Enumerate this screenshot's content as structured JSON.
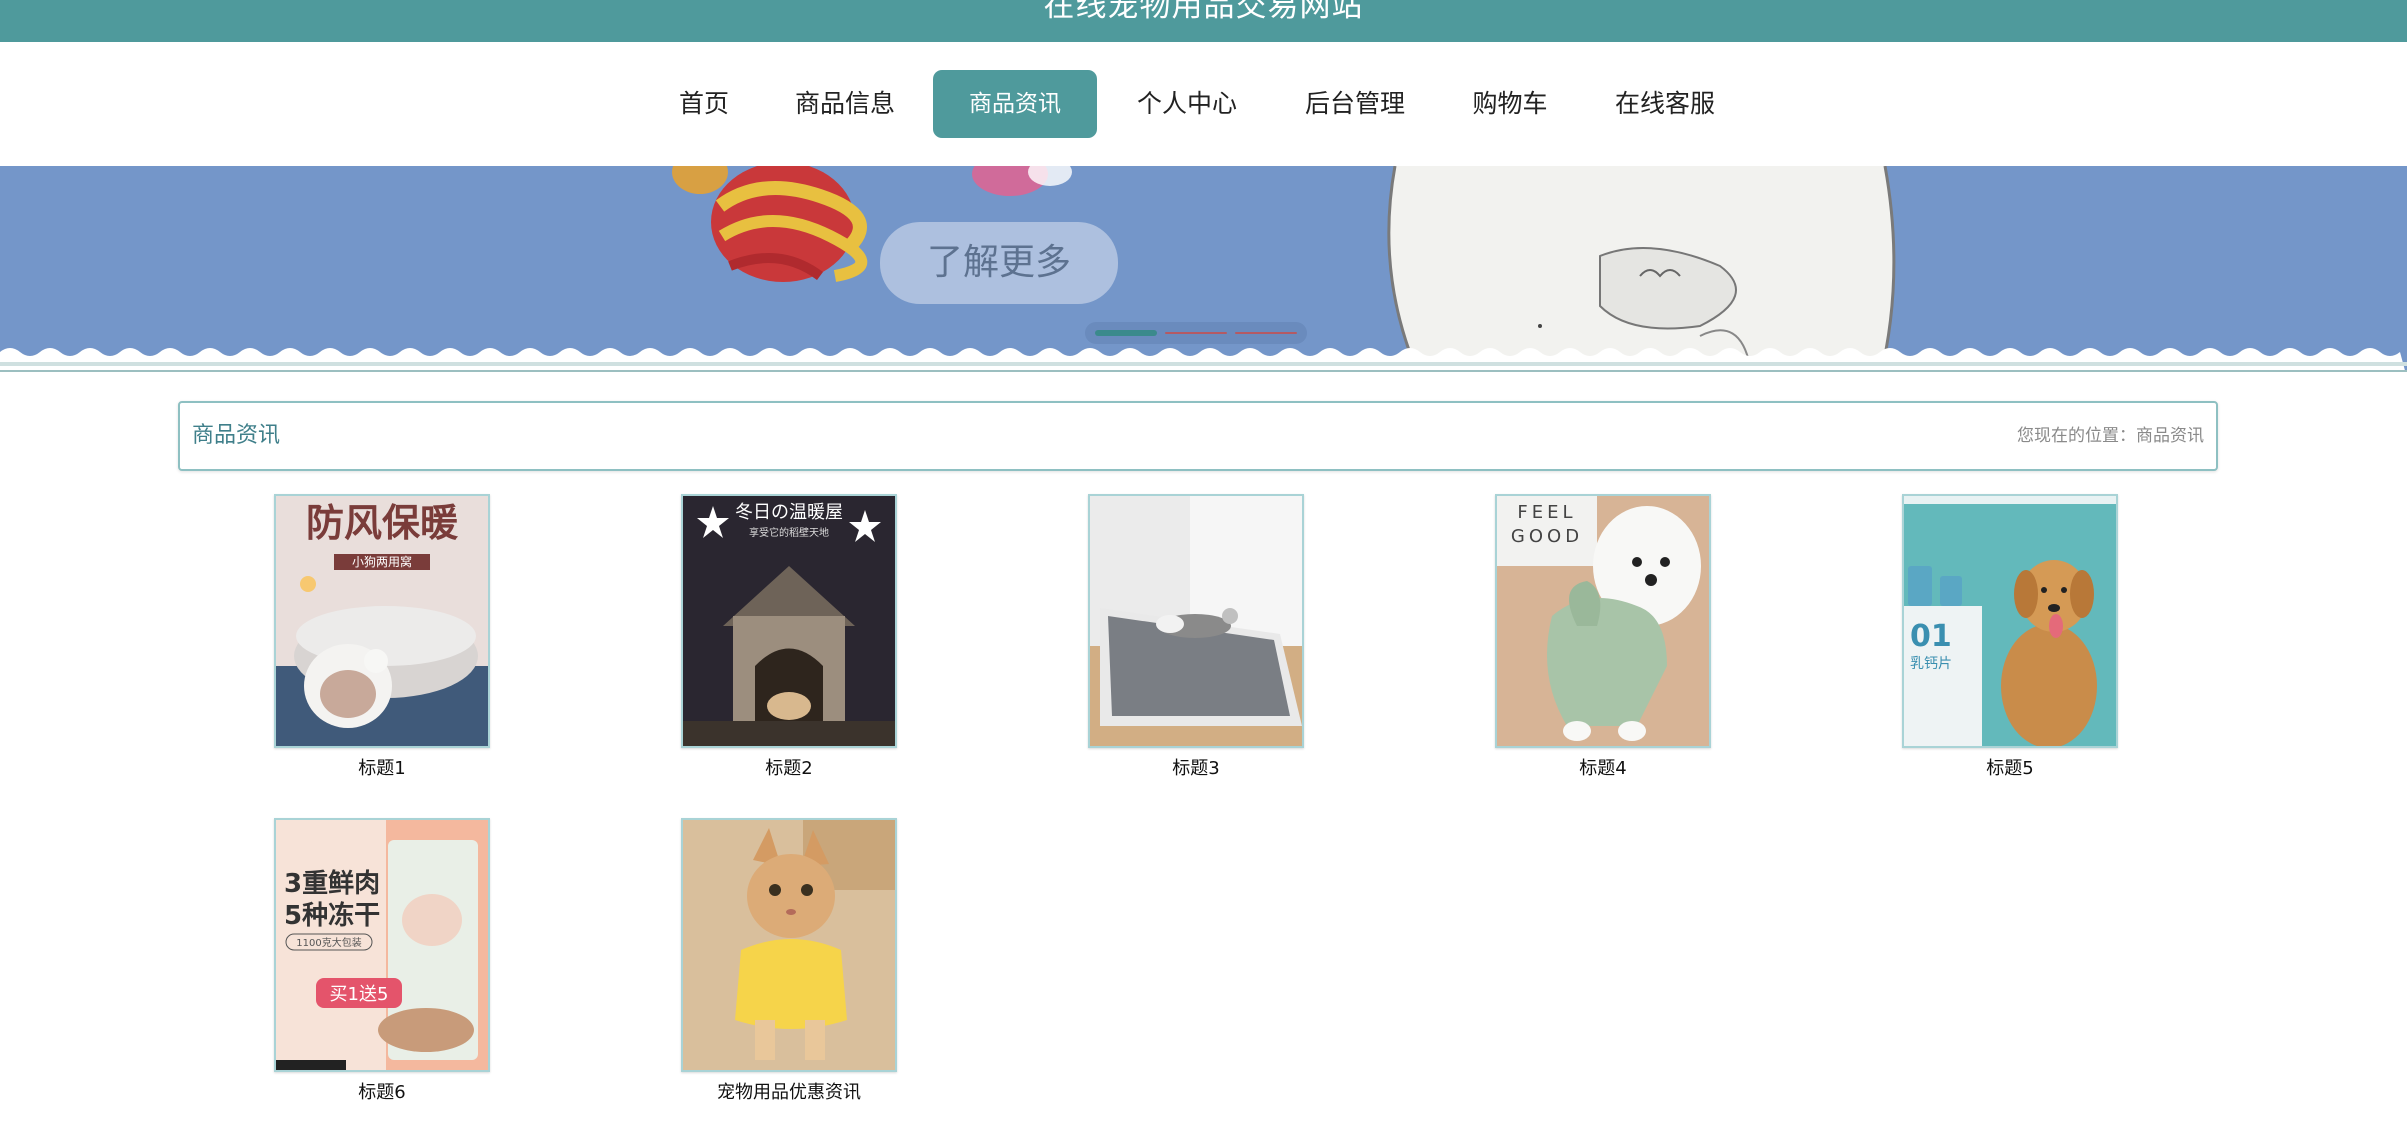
{
  "header": {
    "site_title": "在线宠物用品交易网站"
  },
  "nav": {
    "items": [
      {
        "label": "首页"
      },
      {
        "label": "商品信息"
      },
      {
        "label": "商品资讯",
        "active": true
      },
      {
        "label": "个人中心"
      },
      {
        "label": "后台管理"
      },
      {
        "label": "购物车"
      },
      {
        "label": "在线客服"
      }
    ]
  },
  "banner": {
    "button_label": "了解更多",
    "slide_count": 3,
    "active_slide": 1
  },
  "section": {
    "title": "商品资讯",
    "location_label": "您现在的位置：",
    "location_value": "商品资讯"
  },
  "thumb_text": {
    "t1_main": "防风保暖",
    "t1_sub": "小狗两用窝",
    "t2_main": "冬日の温暖屋",
    "t2_sub": "享受它的稻壁天地",
    "t4_top1": "FEEL",
    "t4_top2": "GOOD",
    "t5_big": "01",
    "t5_sub": "乳钙片",
    "t6_line1": "3重鲜肉",
    "t6_line2": "5种冻干",
    "t6_tag": "1100克大包装",
    "t6_promo": "买1送5"
  },
  "news": [
    {
      "title": "标题1"
    },
    {
      "title": "标题2"
    },
    {
      "title": "标题3"
    },
    {
      "title": "标题4"
    },
    {
      "title": "标题5"
    },
    {
      "title": "标题6"
    },
    {
      "title": "宠物用品优惠资讯"
    }
  ]
}
